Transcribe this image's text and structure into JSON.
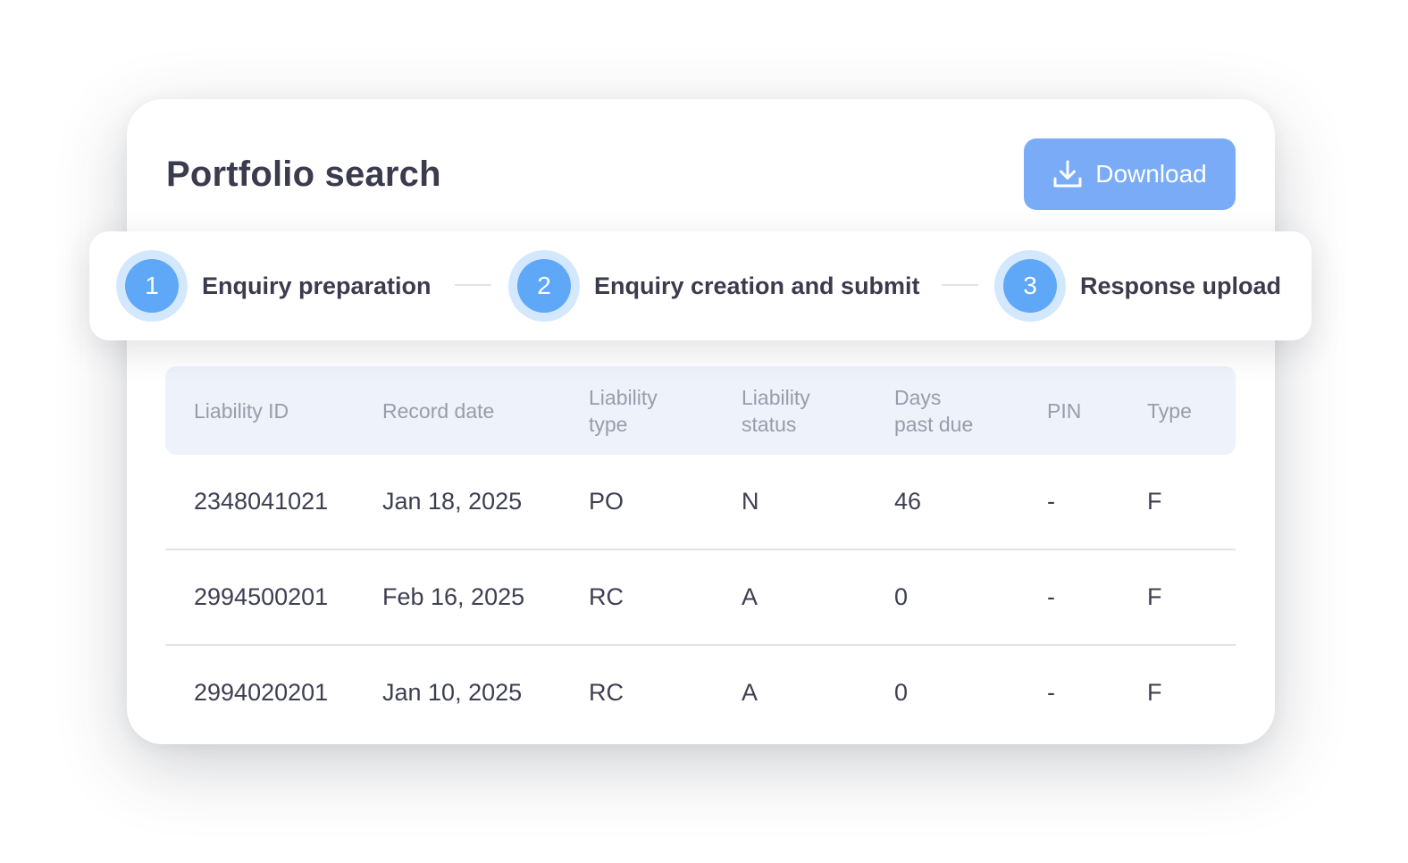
{
  "header": {
    "title": "Portfolio search",
    "download_label": "Download",
    "download_icon": "download-icon"
  },
  "stepper": {
    "steps": [
      {
        "number": "1",
        "label": "Enquiry preparation"
      },
      {
        "number": "2",
        "label": "Enquiry creation and submit"
      },
      {
        "number": "3",
        "label": "Response upload"
      }
    ]
  },
  "table": {
    "columns": [
      {
        "line1": "Liability ID",
        "line2": ""
      },
      {
        "line1": "Record date",
        "line2": ""
      },
      {
        "line1": "Liability",
        "line2": "type"
      },
      {
        "line1": "Liability",
        "line2": "status"
      },
      {
        "line1": "Days",
        "line2": "past due"
      },
      {
        "line1": "PIN",
        "line2": ""
      },
      {
        "line1": "Type",
        "line2": ""
      }
    ],
    "rows": [
      [
        "2348041021",
        "Jan 18, 2025",
        "PO",
        "N",
        "46",
        "-",
        "F"
      ],
      [
        "2994500201",
        "Feb 16, 2025",
        "RC",
        "A",
        "0",
        "-",
        "F"
      ],
      [
        "2994020201",
        "Jan 10, 2025",
        "RC",
        "A",
        "0",
        "-",
        "F"
      ]
    ]
  },
  "colors": {
    "accent": "#7aabf7",
    "step_fill": "#5ea8f7",
    "step_ring": "#d3e7fd",
    "header_bg": "#eef2fb",
    "text_dark": "#3a3c4e",
    "text_muted": "#9a9cab"
  }
}
